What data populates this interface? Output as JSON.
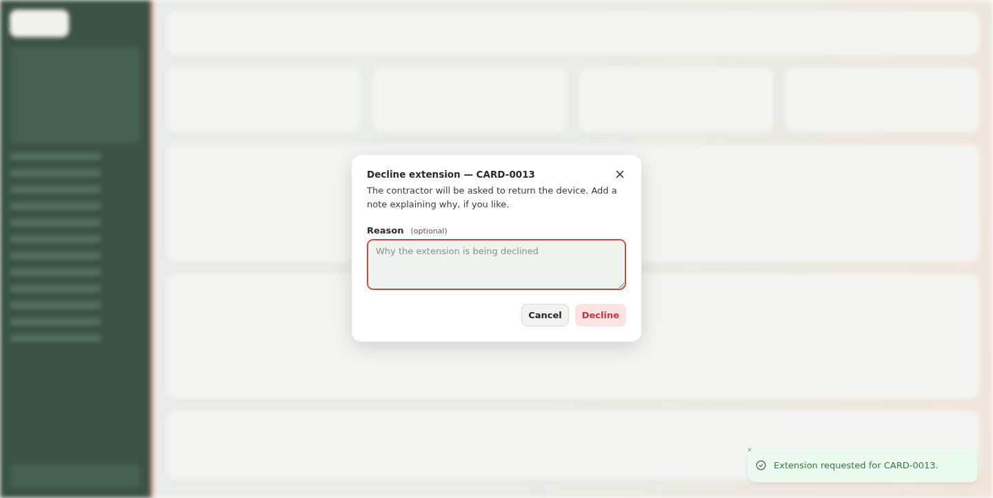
{
  "dialog": {
    "title": "Decline extension — CARD-0013",
    "description": "The contractor will be asked to return the device. Add a note explaining why, if you like.",
    "field": {
      "label": "Reason",
      "hint": "(optional)",
      "placeholder": "Why the extension is being declined"
    },
    "buttons": [
      {
        "label": "Cancel",
        "kind": "secondary"
      },
      {
        "label": "Decline",
        "kind": "danger"
      }
    ]
  },
  "toast": {
    "message": "Extension requested for CARD-0013."
  }
}
